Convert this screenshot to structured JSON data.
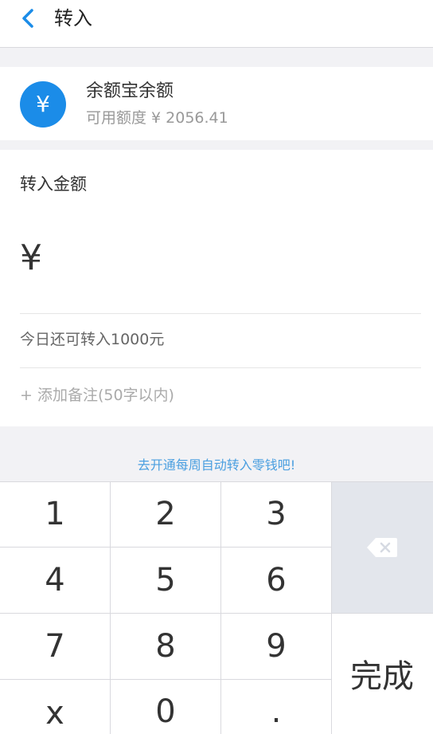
{
  "header": {
    "title": "转入"
  },
  "account": {
    "icon_symbol": "¥",
    "name": "余额宝余额",
    "available": "可用额度 ¥ 2056.41"
  },
  "form": {
    "amount_label": "转入金额",
    "amount_placeholder": "¥",
    "limit_text": "今日还可转入1000元",
    "add_note": "+ 添加备注(50字以内)"
  },
  "auto_transfer_link": "去开通每周自动转入零钱吧!",
  "keypad": {
    "keys": [
      "1",
      "2",
      "3",
      "4",
      "5",
      "6",
      "7",
      "8",
      "9",
      "x",
      "0",
      "."
    ],
    "done_label": "完成"
  },
  "colors": {
    "accent": "#1b8ce8",
    "link": "#4a9fe0",
    "backspace_bg": "#e3e6ec"
  }
}
